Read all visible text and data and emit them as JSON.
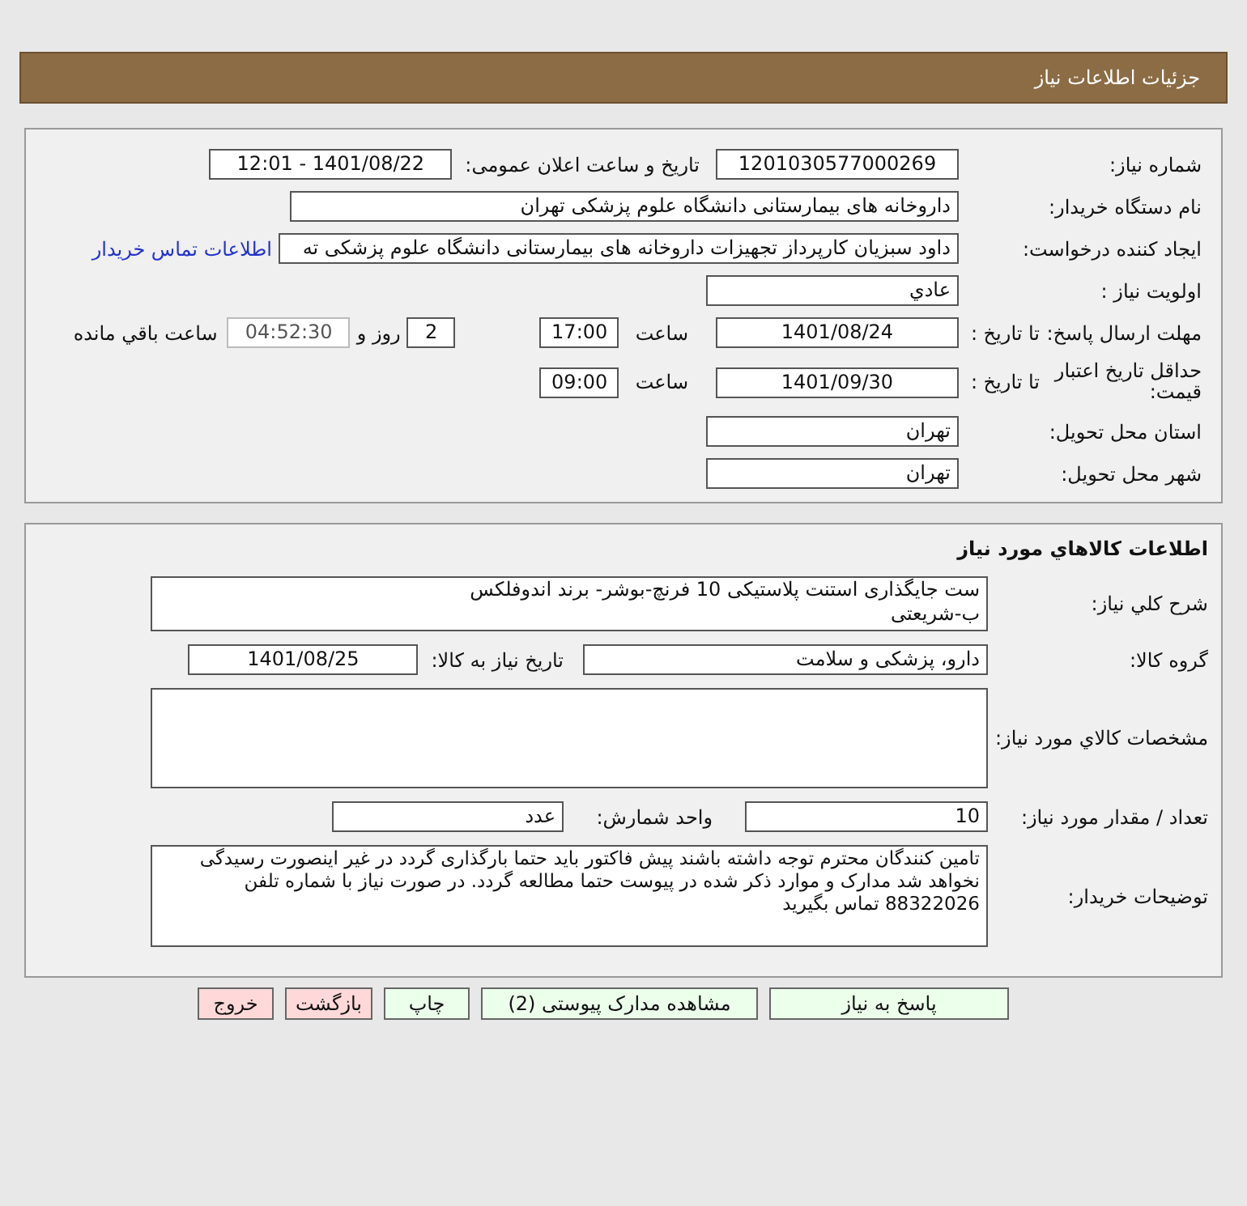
{
  "header": {
    "title": "جزئیات اطلاعات نیاز"
  },
  "need": {
    "need_number": {
      "label": "شماره نیاز:",
      "value": "1201030577000269"
    },
    "announce": {
      "label": "تاریخ و ساعت اعلان عمومی:",
      "value": "1401/08/22 - 12:01"
    },
    "buyer": {
      "label": "نام دستگاه خریدار:",
      "value": "داروخانه های بیمارستانی دانشگاه علوم پزشکی تهران"
    },
    "requester": {
      "label": "ایجاد کننده درخواست:",
      "value": "داود سبزیان کارپرداز تجهیزات داروخانه های بیمارستانی دانشگاه علوم پزشکی ته",
      "link": "اطلاعات تماس خریدار"
    },
    "priority": {
      "label": "اولویت نیاز :",
      "value": "عادي"
    },
    "deadline": {
      "label": "مهلت ارسال پاسخ:",
      "to_label": "تا تاریخ :",
      "date": "1401/08/24",
      "time_label": "ساعت",
      "time": "17:00",
      "days": "2",
      "days_label": "روز و",
      "remaining": "04:52:30",
      "remaining_label": "ساعت باقي مانده"
    },
    "validity": {
      "label": "حداقل تاریخ اعتبار قیمت:",
      "to_label": "تا تاریخ :",
      "date": "1401/09/30",
      "time_label": "ساعت",
      "time": "09:00"
    },
    "province": {
      "label": "استان محل تحویل:",
      "value": "تهران"
    },
    "city": {
      "label": "شهر محل تحویل:",
      "value": "تهران"
    }
  },
  "goods": {
    "title": "اطلاعات کالاهاي مورد نیاز",
    "description": {
      "label": "شرح کلي نیاز:",
      "lines": [
        "ست جایگذاری استنت پلاستیکی 10 فرنچ-بوشر- برند اندوفلکس",
        "ب-شریعتی"
      ]
    },
    "group": {
      "label": "گروه کالا:",
      "value": "دارو، پزشکی و سلامت",
      "date_label": "تاریخ نیاز به کالا:",
      "date": "1401/08/25"
    },
    "specs": {
      "label": "مشخصات کالاي مورد نیاز:"
    },
    "quantity": {
      "label": "تعداد / مقدار مورد نیاز:",
      "value": "10",
      "unit_label": "واحد شمارش:",
      "unit": "عدد"
    },
    "notes": {
      "label": "توضیحات خریدار:",
      "value": "تامین کنندگان محترم توجه داشته باشند پیش فاکتور باید حتما بارگذاری گردد در غیر اینصورت رسیدگی نخواهد شد مدارک و موارد ذکر شده در پیوست حتما مطالعه گردد. در صورت نیاز با شماره تلفن 88322026 تماس بگیرید"
    }
  },
  "buttons": [
    {
      "label": "پاسخ به نیاز",
      "kind": "primary"
    },
    {
      "label": "مشاهده مدارک پیوستی (2)",
      "kind": "primary"
    },
    {
      "label": "چاپ",
      "kind": "primary"
    },
    {
      "label": "بازگشت",
      "kind": "danger"
    },
    {
      "label": "خروج",
      "kind": "danger"
    }
  ]
}
